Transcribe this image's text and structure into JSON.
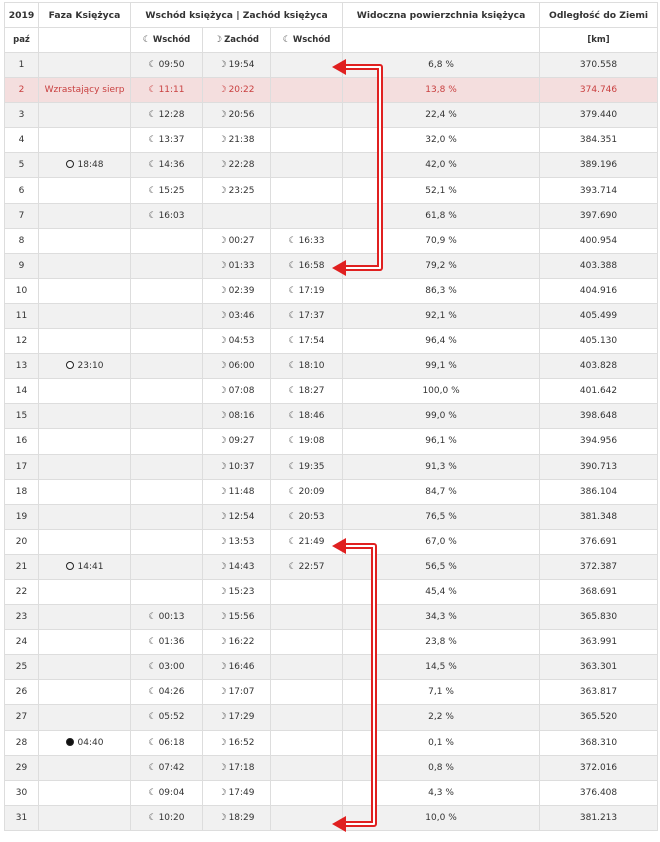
{
  "header": {
    "year": "2019",
    "phase": "Faza Księżyca",
    "rise_set": "Wschód księżyca | Zachód księżyca",
    "surface": "Widoczna powierzchnia księżyca",
    "distance": "Odległość do Ziemi",
    "month": "paź",
    "rise1": "Wschód",
    "set": "Zachód",
    "rise2": "Wschód",
    "unit": "[km]"
  },
  "icons": {
    "rise": "moonrise-icon",
    "set": "moonset-icon"
  },
  "colors": {
    "highlight_bg": "#f4dede",
    "highlight_text": "#c94040",
    "arrow": "#e02020"
  },
  "rows": [
    {
      "day": "1",
      "phase": "",
      "phase_icon": "",
      "rise1": "09:50",
      "set": "19:54",
      "rise2": "",
      "surface": "6,8 %",
      "distance": "370.558"
    },
    {
      "day": "2",
      "phase": "Wzrastający sierp",
      "phase_icon": "",
      "rise1": "11:11",
      "set": "20:22",
      "rise2": "",
      "surface": "13,8 %",
      "distance": "374.746",
      "today": true
    },
    {
      "day": "3",
      "phase": "",
      "phase_icon": "",
      "rise1": "12:28",
      "set": "20:56",
      "rise2": "",
      "surface": "22,4 %",
      "distance": "379.440"
    },
    {
      "day": "4",
      "phase": "",
      "phase_icon": "",
      "rise1": "13:37",
      "set": "21:38",
      "rise2": "",
      "surface": "32,0 %",
      "distance": "384.351"
    },
    {
      "day": "5",
      "phase": "18:48",
      "phase_icon": "first-quarter",
      "rise1": "14:36",
      "set": "22:28",
      "rise2": "",
      "surface": "42,0 %",
      "distance": "389.196"
    },
    {
      "day": "6",
      "phase": "",
      "phase_icon": "",
      "rise1": "15:25",
      "set": "23:25",
      "rise2": "",
      "surface": "52,1 %",
      "distance": "393.714"
    },
    {
      "day": "7",
      "phase": "",
      "phase_icon": "",
      "rise1": "16:03",
      "set": "",
      "rise2": "",
      "surface": "61,8 %",
      "distance": "397.690"
    },
    {
      "day": "8",
      "phase": "",
      "phase_icon": "",
      "rise1": "",
      "set": "00:27",
      "rise2": "16:33",
      "surface": "70,9 %",
      "distance": "400.954"
    },
    {
      "day": "9",
      "phase": "",
      "phase_icon": "",
      "rise1": "",
      "set": "01:33",
      "rise2": "16:58",
      "surface": "79,2 %",
      "distance": "403.388"
    },
    {
      "day": "10",
      "phase": "",
      "phase_icon": "",
      "rise1": "",
      "set": "02:39",
      "rise2": "17:19",
      "surface": "86,3 %",
      "distance": "404.916"
    },
    {
      "day": "11",
      "phase": "",
      "phase_icon": "",
      "rise1": "",
      "set": "03:46",
      "rise2": "17:37",
      "surface": "92,1 %",
      "distance": "405.499"
    },
    {
      "day": "12",
      "phase": "",
      "phase_icon": "",
      "rise1": "",
      "set": "04:53",
      "rise2": "17:54",
      "surface": "96,4 %",
      "distance": "405.130"
    },
    {
      "day": "13",
      "phase": "23:10",
      "phase_icon": "full",
      "rise1": "",
      "set": "06:00",
      "rise2": "18:10",
      "surface": "99,1 %",
      "distance": "403.828"
    },
    {
      "day": "14",
      "phase": "",
      "phase_icon": "",
      "rise1": "",
      "set": "07:08",
      "rise2": "18:27",
      "surface": "100,0 %",
      "distance": "401.642"
    },
    {
      "day": "15",
      "phase": "",
      "phase_icon": "",
      "rise1": "",
      "set": "08:16",
      "rise2": "18:46",
      "surface": "99,0 %",
      "distance": "398.648"
    },
    {
      "day": "16",
      "phase": "",
      "phase_icon": "",
      "rise1": "",
      "set": "09:27",
      "rise2": "19:08",
      "surface": "96,1 %",
      "distance": "394.956"
    },
    {
      "day": "17",
      "phase": "",
      "phase_icon": "",
      "rise1": "",
      "set": "10:37",
      "rise2": "19:35",
      "surface": "91,3 %",
      "distance": "390.713"
    },
    {
      "day": "18",
      "phase": "",
      "phase_icon": "",
      "rise1": "",
      "set": "11:48",
      "rise2": "20:09",
      "surface": "84,7 %",
      "distance": "386.104"
    },
    {
      "day": "19",
      "phase": "",
      "phase_icon": "",
      "rise1": "",
      "set": "12:54",
      "rise2": "20:53",
      "surface": "76,5 %",
      "distance": "381.348"
    },
    {
      "day": "20",
      "phase": "",
      "phase_icon": "",
      "rise1": "",
      "set": "13:53",
      "rise2": "21:49",
      "surface": "67,0 %",
      "distance": "376.691"
    },
    {
      "day": "21",
      "phase": "14:41",
      "phase_icon": "last-quarter",
      "rise1": "",
      "set": "14:43",
      "rise2": "22:57",
      "surface": "56,5 %",
      "distance": "372.387"
    },
    {
      "day": "22",
      "phase": "",
      "phase_icon": "",
      "rise1": "",
      "set": "15:23",
      "rise2": "",
      "surface": "45,4 %",
      "distance": "368.691"
    },
    {
      "day": "23",
      "phase": "",
      "phase_icon": "",
      "rise1": "00:13",
      "set": "15:56",
      "rise2": "",
      "surface": "34,3 %",
      "distance": "365.830"
    },
    {
      "day": "24",
      "phase": "",
      "phase_icon": "",
      "rise1": "01:36",
      "set": "16:22",
      "rise2": "",
      "surface": "23,8 %",
      "distance": "363.991"
    },
    {
      "day": "25",
      "phase": "",
      "phase_icon": "",
      "rise1": "03:00",
      "set": "16:46",
      "rise2": "",
      "surface": "14,5 %",
      "distance": "363.301"
    },
    {
      "day": "26",
      "phase": "",
      "phase_icon": "",
      "rise1": "04:26",
      "set": "17:07",
      "rise2": "",
      "surface": "7,1 %",
      "distance": "363.817"
    },
    {
      "day": "27",
      "phase": "",
      "phase_icon": "",
      "rise1": "05:52",
      "set": "17:29",
      "rise2": "",
      "surface": "2,2 %",
      "distance": "365.520"
    },
    {
      "day": "28",
      "phase": "04:40",
      "phase_icon": "new",
      "rise1": "06:18",
      "set": "16:52",
      "rise2": "",
      "surface": "0,1 %",
      "distance": "368.310"
    },
    {
      "day": "29",
      "phase": "",
      "phase_icon": "",
      "rise1": "07:42",
      "set": "17:18",
      "rise2": "",
      "surface": "0,8 %",
      "distance": "372.016"
    },
    {
      "day": "30",
      "phase": "",
      "phase_icon": "",
      "rise1": "09:04",
      "set": "17:49",
      "rise2": "",
      "surface": "4,3 %",
      "distance": "376.408"
    },
    {
      "day": "31",
      "phase": "",
      "phase_icon": "",
      "rise1": "10:20",
      "set": "18:29",
      "rise2": "",
      "surface": "10,0 %",
      "distance": "381.213"
    }
  ]
}
